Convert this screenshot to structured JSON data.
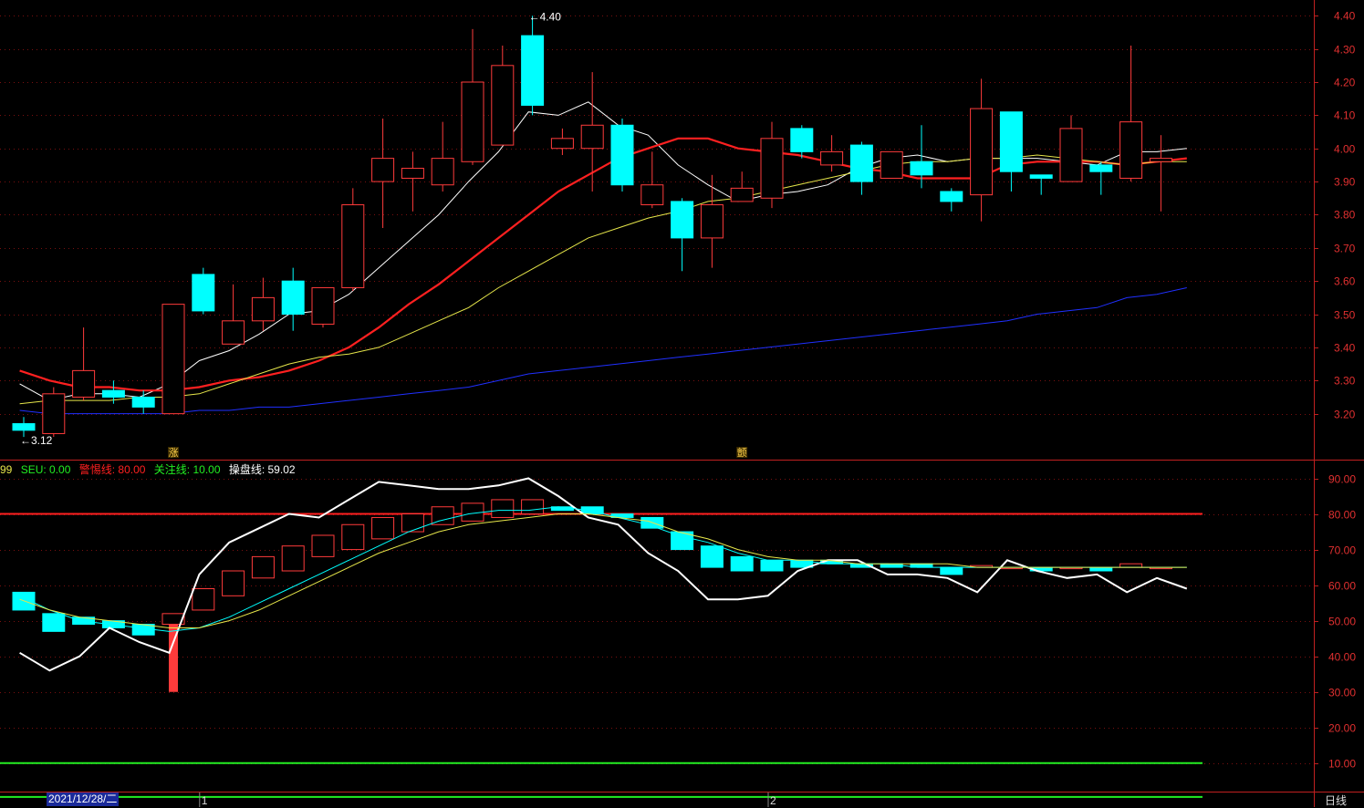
{
  "colors": {
    "up": "#ff3b3b",
    "down": "#00ffff",
    "ma_white": "#ffffff",
    "ma_red": "#ff2020",
    "ma_yellow": "#e6e64a",
    "ma_blue": "#2030ff",
    "grid": "#7a1010",
    "axis": "#c02020",
    "warn_line": "#ff2020",
    "focus_line": "#22ee22",
    "osc_line": "#ffffff"
  },
  "footer": {
    "date": "2021/12/28/二",
    "period": "日线",
    "month_marks": [
      {
        "idx": 6,
        "text": "1"
      },
      {
        "idx": 25,
        "text": "2"
      }
    ]
  },
  "annotations": {
    "high_label": "4.40",
    "low_label": "3.12",
    "high_idx": 17,
    "low_idx": 0,
    "signals": [
      {
        "idx": 5,
        "text": "涨"
      },
      {
        "idx": 24,
        "text": "颤"
      }
    ]
  },
  "legend": [
    {
      "text": "99",
      "color": "#e6e64a"
    },
    {
      "text": "SEU: 0.00",
      "color": "#22ee22"
    },
    {
      "text": "警惕线: 80.00",
      "color": "#ff2020"
    },
    {
      "text": "关注线: 10.00",
      "color": "#22ee22"
    },
    {
      "text": "操盘线: 59.02",
      "color": "#ffffff"
    }
  ],
  "chart_data": [
    {
      "type": "candlestick",
      "ylim": [
        3.1,
        4.42
      ],
      "ticks": [
        4.4,
        4.3,
        4.2,
        4.1,
        4.0,
        3.9,
        3.8,
        3.7,
        3.6,
        3.5,
        3.4,
        3.3,
        3.2
      ],
      "tick_labels": [
        "4.40",
        "4.30",
        "4.20",
        "4.10",
        "4.00",
        "3.90",
        "3.80",
        "3.70",
        "3.60",
        "3.50",
        "3.40",
        "3.30",
        "3.20"
      ],
      "candles": [
        {
          "o": 3.17,
          "c": 3.15,
          "h": 3.19,
          "l": 3.13
        },
        {
          "o": 3.14,
          "c": 3.26,
          "h": 3.28,
          "l": 3.13
        },
        {
          "o": 3.25,
          "c": 3.33,
          "h": 3.46,
          "l": 3.24
        },
        {
          "o": 3.27,
          "c": 3.25,
          "h": 3.3,
          "l": 3.23
        },
        {
          "o": 3.25,
          "c": 3.22,
          "h": 3.27,
          "l": 3.2
        },
        {
          "o": 3.2,
          "c": 3.53,
          "h": 3.53,
          "l": 3.2
        },
        {
          "o": 3.62,
          "c": 3.51,
          "h": 3.64,
          "l": 3.5
        },
        {
          "o": 3.41,
          "c": 3.48,
          "h": 3.59,
          "l": 3.41
        },
        {
          "o": 3.48,
          "c": 3.55,
          "h": 3.61,
          "l": 3.45
        },
        {
          "o": 3.6,
          "c": 3.5,
          "h": 3.64,
          "l": 3.45
        },
        {
          "o": 3.47,
          "c": 3.58,
          "h": 3.58,
          "l": 3.46
        },
        {
          "o": 3.58,
          "c": 3.83,
          "h": 3.88,
          "l": 3.57
        },
        {
          "o": 3.9,
          "c": 3.97,
          "h": 4.09,
          "l": 3.76
        },
        {
          "o": 3.91,
          "c": 3.94,
          "h": 3.99,
          "l": 3.81
        },
        {
          "o": 3.89,
          "c": 3.97,
          "h": 4.08,
          "l": 3.87
        },
        {
          "o": 3.96,
          "c": 4.2,
          "h": 4.36,
          "l": 3.95
        },
        {
          "o": 4.01,
          "c": 4.25,
          "h": 4.31,
          "l": 4.01
        },
        {
          "o": 4.34,
          "c": 4.13,
          "h": 4.4,
          "l": 4.1
        },
        {
          "o": 4.0,
          "c": 4.03,
          "h": 4.06,
          "l": 3.98
        },
        {
          "o": 4.0,
          "c": 4.07,
          "h": 4.23,
          "l": 3.87
        },
        {
          "o": 4.07,
          "c": 3.89,
          "h": 4.09,
          "l": 3.87
        },
        {
          "o": 3.83,
          "c": 3.89,
          "h": 3.99,
          "l": 3.82
        },
        {
          "o": 3.84,
          "c": 3.73,
          "h": 3.85,
          "l": 3.63
        },
        {
          "o": 3.73,
          "c": 3.83,
          "h": 3.92,
          "l": 3.64
        },
        {
          "o": 3.84,
          "c": 3.88,
          "h": 3.93,
          "l": 3.84
        },
        {
          "o": 3.85,
          "c": 4.03,
          "h": 4.08,
          "l": 3.82
        },
        {
          "o": 4.06,
          "c": 3.99,
          "h": 4.07,
          "l": 3.97
        },
        {
          "o": 3.95,
          "c": 3.99,
          "h": 4.04,
          "l": 3.93
        },
        {
          "o": 4.01,
          "c": 3.9,
          "h": 4.02,
          "l": 3.86
        },
        {
          "o": 3.91,
          "c": 3.99,
          "h": 3.99,
          "l": 3.91
        },
        {
          "o": 3.96,
          "c": 3.92,
          "h": 4.07,
          "l": 3.88
        },
        {
          "o": 3.87,
          "c": 3.84,
          "h": 3.88,
          "l": 3.81
        },
        {
          "o": 3.86,
          "c": 4.12,
          "h": 4.21,
          "l": 3.78
        },
        {
          "o": 4.11,
          "c": 3.93,
          "h": 4.11,
          "l": 3.87
        },
        {
          "o": 3.92,
          "c": 3.91,
          "h": 3.92,
          "l": 3.86
        },
        {
          "o": 3.9,
          "c": 4.06,
          "h": 4.1,
          "l": 3.9
        },
        {
          "o": 3.95,
          "c": 3.93,
          "h": 3.96,
          "l": 3.86
        },
        {
          "o": 3.91,
          "c": 4.08,
          "h": 4.31,
          "l": 3.9
        },
        {
          "o": 3.96,
          "c": 3.97,
          "h": 4.04,
          "l": 3.81
        }
      ],
      "series": [
        {
          "color_key": "ma_white",
          "values": [
            3.29,
            3.24,
            3.26,
            3.26,
            3.25,
            3.29,
            3.36,
            3.39,
            3.44,
            3.5,
            3.51,
            3.56,
            3.64,
            3.72,
            3.8,
            3.9,
            3.99,
            4.11,
            4.1,
            4.14,
            4.07,
            4.04,
            3.95,
            3.89,
            3.84,
            3.86,
            3.87,
            3.89,
            3.94,
            3.97,
            3.98,
            3.96,
            3.97,
            3.97,
            3.97,
            3.96,
            3.95,
            3.99,
            3.99,
            4.0
          ]
        },
        {
          "color_key": "ma_red",
          "values": [
            3.33,
            3.3,
            3.28,
            3.28,
            3.27,
            3.27,
            3.28,
            3.3,
            3.31,
            3.33,
            3.36,
            3.4,
            3.46,
            3.53,
            3.59,
            3.66,
            3.73,
            3.8,
            3.87,
            3.92,
            3.97,
            4.0,
            4.03,
            4.03,
            4.0,
            3.99,
            3.98,
            3.96,
            3.94,
            3.93,
            3.91,
            3.91,
            3.91,
            3.95,
            3.96,
            3.96,
            3.96,
            3.95,
            3.96,
            3.97
          ]
        },
        {
          "color_key": "ma_yellow",
          "values": [
            3.23,
            3.24,
            3.24,
            3.24,
            3.25,
            3.25,
            3.26,
            3.29,
            3.32,
            3.35,
            3.37,
            3.38,
            3.4,
            3.44,
            3.48,
            3.52,
            3.58,
            3.63,
            3.68,
            3.73,
            3.76,
            3.79,
            3.81,
            3.84,
            3.85,
            3.87,
            3.89,
            3.91,
            3.93,
            3.95,
            3.96,
            3.96,
            3.97,
            3.97,
            3.98,
            3.97,
            3.96,
            3.95,
            3.96,
            3.96
          ]
        },
        {
          "color_key": "ma_blue",
          "values": [
            3.21,
            3.2,
            3.2,
            3.2,
            3.2,
            3.2,
            3.21,
            3.21,
            3.22,
            3.22,
            3.23,
            3.24,
            3.25,
            3.26,
            3.27,
            3.28,
            3.3,
            3.32,
            3.33,
            3.34,
            3.35,
            3.36,
            3.37,
            3.38,
            3.39,
            3.4,
            3.41,
            3.42,
            3.43,
            3.44,
            3.45,
            3.46,
            3.47,
            3.48,
            3.5,
            3.51,
            3.52,
            3.55,
            3.56,
            3.58
          ]
        }
      ]
    },
    {
      "type": "oscillator",
      "ylim": [
        2,
        95
      ],
      "ticks": [
        90,
        80,
        70,
        60,
        50,
        40,
        30,
        20,
        10
      ],
      "tick_labels": [
        "90.00",
        "80.00",
        "70.00",
        "60.00",
        "50.00",
        "40.00",
        "30.00",
        "20.00",
        "10.00"
      ],
      "ref_lines": [
        {
          "value": 80,
          "color_key": "warn_line"
        },
        {
          "value": 10,
          "color_key": "focus_line"
        },
        {
          "value": 0.5,
          "color_key": "focus_line"
        }
      ],
      "boxes": [
        {
          "o": 58,
          "c": 53
        },
        {
          "o": 52,
          "c": 47
        },
        {
          "o": 51,
          "c": 49
        },
        {
          "o": 50,
          "c": 48
        },
        {
          "o": 49,
          "c": 46
        },
        {
          "o": 49,
          "c": 52
        },
        {
          "o": 53,
          "c": 59
        },
        {
          "o": 57,
          "c": 64
        },
        {
          "o": 62,
          "c": 68
        },
        {
          "o": 64,
          "c": 71
        },
        {
          "o": 68,
          "c": 74
        },
        {
          "o": 70,
          "c": 77
        },
        {
          "o": 73,
          "c": 79
        },
        {
          "o": 75,
          "c": 80
        },
        {
          "o": 77,
          "c": 82
        },
        {
          "o": 78,
          "c": 83
        },
        {
          "o": 79,
          "c": 84
        },
        {
          "o": 80,
          "c": 84
        },
        {
          "o": 82,
          "c": 81
        },
        {
          "o": 82,
          "c": 80
        },
        {
          "o": 80,
          "c": 79
        },
        {
          "o": 79,
          "c": 76
        },
        {
          "o": 75,
          "c": 70
        },
        {
          "o": 71,
          "c": 65
        },
        {
          "o": 68,
          "c": 64
        },
        {
          "o": 67,
          "c": 64
        },
        {
          "o": 67,
          "c": 65
        },
        {
          "o": 67,
          "c": 66
        },
        {
          "o": 66,
          "c": 65
        },
        {
          "o": 66,
          "c": 65
        },
        {
          "o": 66,
          "c": 65
        },
        {
          "o": 65,
          "c": 63
        },
        {
          "o": 65,
          "c": 65.5
        },
        {
          "o": 65,
          "c": 65
        },
        {
          "o": 65,
          "c": 64
        },
        {
          "o": 65,
          "c": 65
        },
        {
          "o": 65,
          "c": 64
        },
        {
          "o": 65,
          "c": 66
        },
        {
          "o": 65,
          "c": 65
        }
      ],
      "spike": {
        "idx": 5,
        "top": 49,
        "bottom": 30
      },
      "series": [
        {
          "color_key": "osc_line",
          "values": [
            41,
            36,
            40,
            48,
            44,
            41,
            63,
            72,
            76,
            80,
            79,
            84,
            89,
            88,
            87,
            87,
            88,
            90,
            85,
            79,
            77,
            69,
            64,
            56,
            56,
            57,
            64,
            67,
            67,
            63,
            63,
            62,
            58,
            67,
            64,
            62,
            63,
            58,
            62,
            59
          ]
        },
        {
          "color_key": "down",
          "values": [
            57,
            53,
            50,
            49,
            48,
            47,
            48,
            51,
            55,
            59,
            63,
            67,
            71,
            75,
            78,
            80,
            81,
            81,
            82,
            81,
            79,
            77,
            74,
            72,
            69,
            67,
            67,
            66,
            66,
            66,
            65,
            65,
            65,
            65,
            65,
            65,
            65,
            65,
            65,
            65
          ]
        },
        {
          "color_key": "ma_yellow",
          "values": [
            56,
            53,
            51,
            50,
            49,
            48,
            48,
            50,
            53,
            57,
            61,
            65,
            69,
            72,
            75,
            77,
            78,
            79,
            80,
            80,
            79,
            78,
            75,
            73,
            70,
            68,
            67,
            67,
            66,
            66,
            66,
            66,
            65,
            65,
            65,
            65,
            65,
            65,
            65,
            65
          ]
        }
      ]
    }
  ]
}
